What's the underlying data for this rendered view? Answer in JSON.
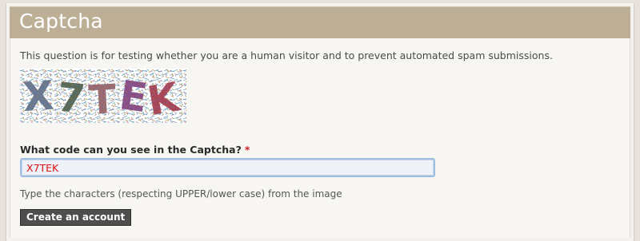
{
  "header": {
    "title": "Captcha"
  },
  "captcha": {
    "description": "This question is for testing whether you are a human visitor and to prevent automated spam submissions.",
    "image_text": "X7TEK",
    "label": "What code can you see in the Captcha?",
    "required_marker": "*",
    "input_value": "X7TEK",
    "hint": "Type the characters (respecting UPPER/lower case) from the image"
  },
  "form": {
    "submit_label": "Create an account"
  },
  "colors": {
    "header_bg": "#bdae96",
    "input_text": "#dd1111",
    "required": "#cc2222",
    "button_bg": "#4e4e4e"
  }
}
